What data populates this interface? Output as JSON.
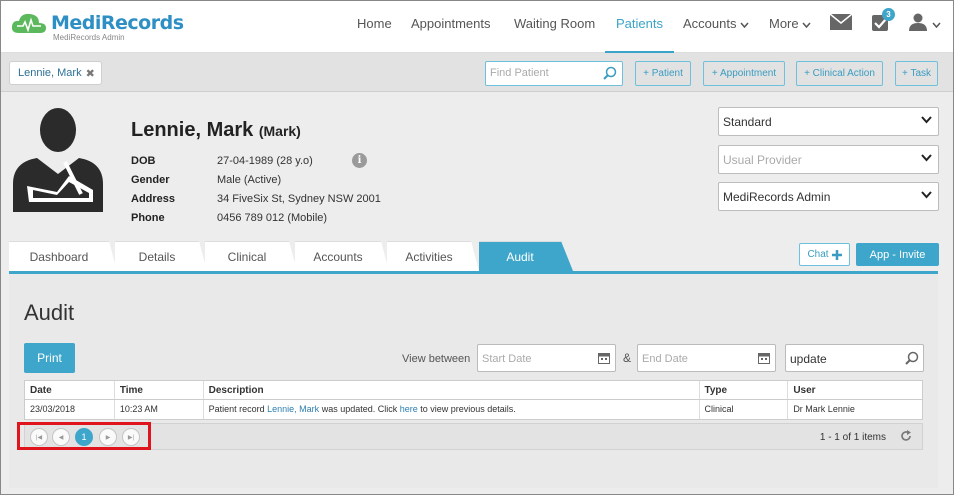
{
  "app": {
    "logo_name": "MediRecords",
    "logo_subtitle": "MediRecords Admin"
  },
  "nav": {
    "items": [
      {
        "label": "Home"
      },
      {
        "label": "Appointments"
      },
      {
        "label": "Waiting Room"
      },
      {
        "label": "Patients",
        "active": true
      },
      {
        "label": "Accounts"
      },
      {
        "label": "More"
      }
    ],
    "tasks_badge": "3"
  },
  "tagbar": {
    "patient_chip": "Lennie, Mark",
    "find_placeholder": "Find Patient",
    "buttons": [
      "+ Patient",
      "+ Appointment",
      "+ Clinical Action",
      "+ Task"
    ]
  },
  "patient": {
    "name": "Lennie, Mark",
    "preferred": "(Mark)",
    "fields": [
      {
        "label": "DOB",
        "value": "27-04-1989 (28 y.o)"
      },
      {
        "label": "Gender",
        "value": "Male (Active)"
      },
      {
        "label": "Address",
        "value": "34 FiveSix St, Sydney NSW 2001"
      },
      {
        "label": "Phone",
        "value": "0456 789 012 (Mobile)"
      }
    ],
    "selects": [
      {
        "value": "Standard",
        "placeholder": false
      },
      {
        "value": "Usual Provider",
        "placeholder": true
      },
      {
        "value": "MediRecords Admin",
        "placeholder": false
      }
    ]
  },
  "tabs": [
    {
      "label": "Dashboard"
    },
    {
      "label": "Details"
    },
    {
      "label": "Clinical"
    },
    {
      "label": "Accounts"
    },
    {
      "label": "Activities"
    },
    {
      "label": "Audit",
      "active": true
    }
  ],
  "actions": {
    "chat": "Chat",
    "invite": "App - Invite"
  },
  "audit": {
    "title": "Audit",
    "print": "Print",
    "view_between": "View between",
    "amp": "&",
    "start_placeholder": "Start Date",
    "end_placeholder": "End Date",
    "search_value": "update",
    "columns": [
      "Date",
      "Time",
      "Description",
      "Type",
      "User"
    ],
    "rows": [
      {
        "date": "23/03/2018",
        "time": "10:23 AM",
        "desc_pre": "Patient record ",
        "desc_link": "Lennie, Mark",
        "desc_mid": " was updated. Click ",
        "desc_link2": "here",
        "desc_post": " to view previous details.",
        "type": "Clinical",
        "user": "Dr Mark Lennie"
      }
    ],
    "pager": {
      "current_page": "1",
      "info": "1 - 1 of 1 items"
    }
  },
  "colors": {
    "accent": "#3ea6cb",
    "highlight": "#e0141c"
  }
}
